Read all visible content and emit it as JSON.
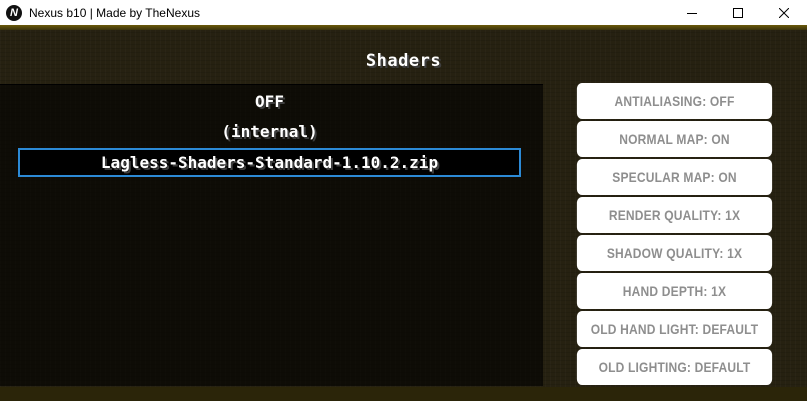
{
  "window": {
    "logo_letter": "N",
    "title": "Nexus b10 | Made by TheNexus"
  },
  "screen": {
    "title": "Shaders"
  },
  "shader_packs": [
    {
      "label": "OFF",
      "selected": false
    },
    {
      "label": "(internal)",
      "selected": false
    },
    {
      "label": "Lagless-Shaders-Standard-1.10.2.zip",
      "selected": true
    }
  ],
  "options": [
    {
      "label": "ANTIALIASING: OFF"
    },
    {
      "label": "NORMAL MAP: ON"
    },
    {
      "label": "SPECULAR MAP: ON"
    },
    {
      "label": "RENDER QUALITY: 1X"
    },
    {
      "label": "SHADOW QUALITY: 1X"
    },
    {
      "label": "HAND DEPTH: 1X"
    },
    {
      "label": "OLD HAND LIGHT: DEFAULT"
    },
    {
      "label": "OLD LIGHTING: DEFAULT"
    }
  ],
  "colors": {
    "selection_border": "#2c8ad6",
    "button_bg": "#ffffff",
    "button_text": "#8e8e8e"
  }
}
